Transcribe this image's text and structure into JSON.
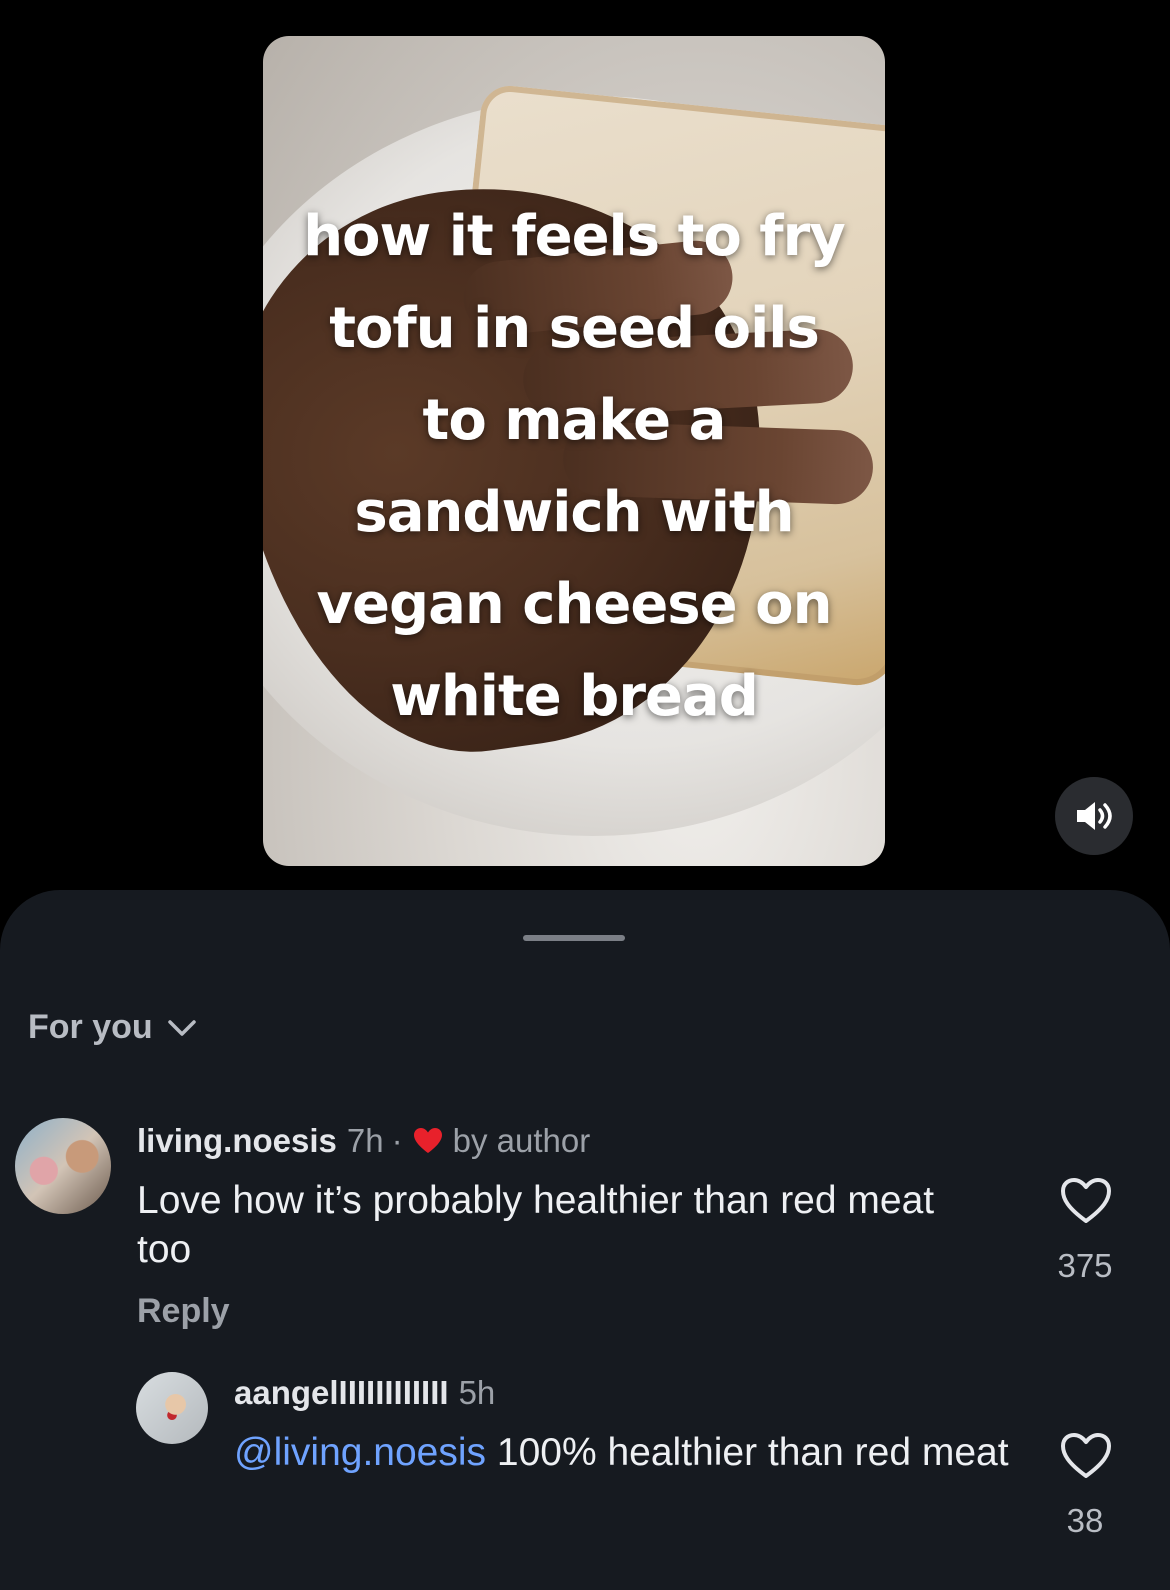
{
  "video": {
    "overlay_text": "how it feels to fry tofu in seed oils to make a sandwich with vegan cheese on white bread",
    "sound_icon": "speaker-on-icon"
  },
  "sheet": {
    "filter_label": "For you",
    "filter_icon": "chevron-down-icon"
  },
  "comments": [
    {
      "username": "living.noesis",
      "time": "7h",
      "liked_by_author_label": "by author",
      "text": "Love how it’s probably healthier than red meat too",
      "reply_label": "Reply",
      "like_count": "375"
    }
  ],
  "replies": [
    {
      "username": "aangelIIIIIIIIIIII",
      "time": "5h",
      "mention": "@living.noesis",
      "text": " 100% healthier than red meat",
      "like_count": "38"
    }
  ],
  "colors": {
    "sheet_bg": "#161a20",
    "mention": "#6fa3ff",
    "heart_red": "#e8212b"
  }
}
